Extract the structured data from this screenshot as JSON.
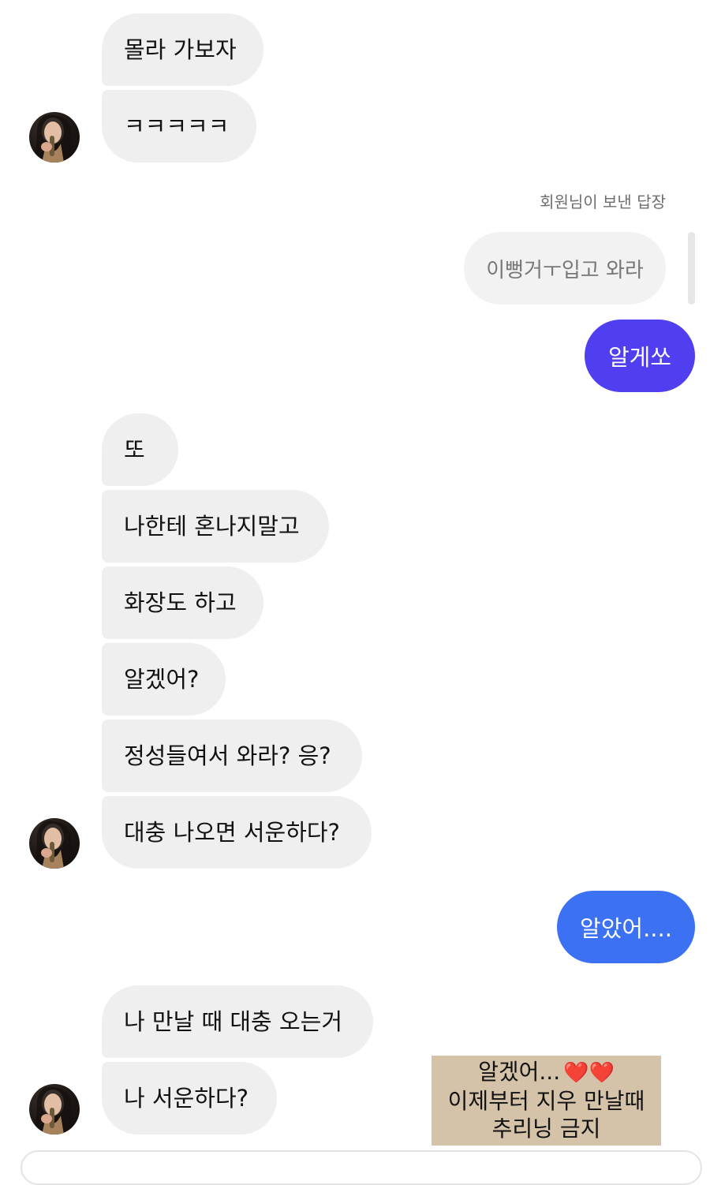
{
  "conversation": {
    "group1": {
      "messages": [
        "몰라 가보자",
        "ㅋㅋㅋㅋㅋ"
      ]
    },
    "reply": {
      "caption": "회원님이 보낸 답장",
      "quoted": "이뻥거ㅜ입고 와라"
    },
    "outgoing1": {
      "text": "알게쏘",
      "color": "#4f3ff0"
    },
    "group2": {
      "messages": [
        "또",
        "나한테 혼나지말고",
        "화장도 하고",
        "알겠어?",
        "정성들여서 와라? 응?",
        "대충 나오면 서운하다?"
      ]
    },
    "outgoing2": {
      "text": "알았어....",
      "color": "#3b71f2"
    },
    "group3": {
      "messages": [
        "나 만날 때 대충 오는거",
        "나 서운하다?"
      ]
    }
  },
  "overlay_caption": {
    "line1": "알겠어...",
    "hearts": "❤️❤️",
    "line2": "이제부터 지우 만날때",
    "line3": "추리닝 금지",
    "background": "#d5c3a9"
  },
  "icons": {
    "avatar": "profile-photo",
    "heart": "red-heart-emoji"
  }
}
